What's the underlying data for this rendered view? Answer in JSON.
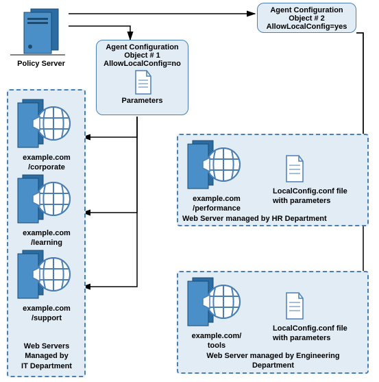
{
  "policyServer": {
    "label": "Policy Server"
  },
  "config1": {
    "title_l1": "Agent Configuration",
    "title_l2": "Object # 1",
    "title_l3": "AllowLocalConfig=no",
    "paramsLabel": "Parameters"
  },
  "config2": {
    "title_l1": "Agent Configuration",
    "title_l2": "Object # 2",
    "title_l3": "AllowLocalConfig=yes"
  },
  "itDept": {
    "servers": [
      {
        "url_l1": "example.com",
        "url_l2": "/corporate"
      },
      {
        "url_l1": "example.com",
        "url_l2": "/learning"
      },
      {
        "url_l1": "example.com",
        "url_l2": "/support"
      }
    ],
    "caption_l1": "Web Servers",
    "caption_l2": "Managed by",
    "caption_l3": "IT Department"
  },
  "hrDept": {
    "server": {
      "url_l1": "example.com",
      "url_l2": "/performance"
    },
    "fileLabel_l1": "LocalConfig.conf file",
    "fileLabel_l2": "with parameters",
    "caption": "Web Server managed by HR Department"
  },
  "engDept": {
    "server": {
      "url_l1": "example.com/",
      "url_l2": "tools"
    },
    "fileLabel_l1": "LocalConfig.conf file",
    "fileLabel_l2": "with parameters",
    "caption_l1": "Web Server managed by Engineering",
    "caption_l2": "Department"
  }
}
